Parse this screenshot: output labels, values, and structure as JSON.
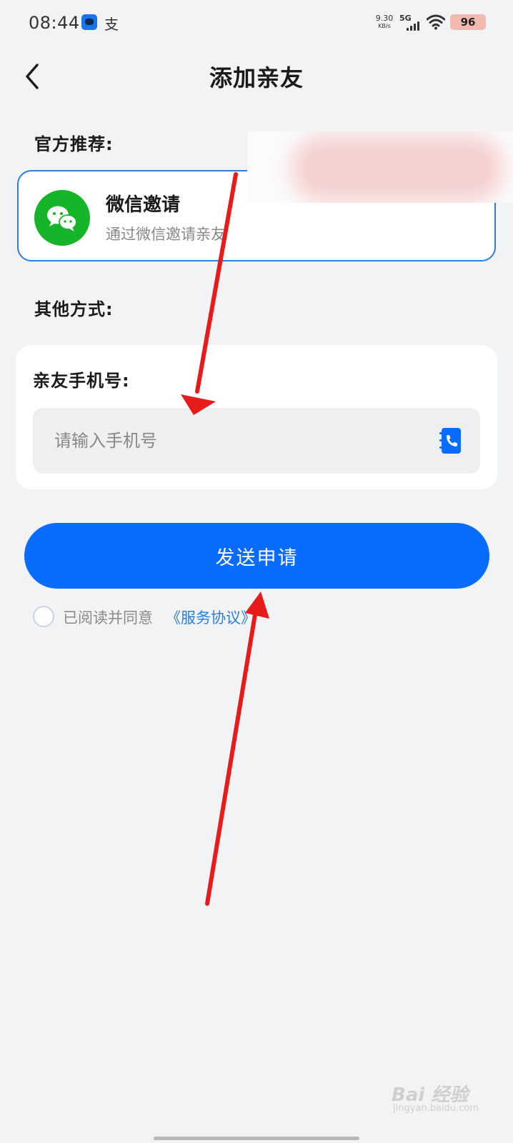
{
  "status_bar": {
    "time": "08:44",
    "app_icons": [
      "app-notification-icon",
      "alipay-icon"
    ],
    "app_glyph": "支",
    "speed_value": "9.30",
    "speed_unit": "KB/s",
    "network": "5G",
    "battery": "96"
  },
  "header": {
    "back_icon": "chevron-left-icon",
    "title": "添加亲友"
  },
  "official": {
    "label": "官方推荐:",
    "wechat_title": "微信邀请",
    "wechat_desc": "通过微信邀请亲友",
    "icon": "wechat-icon"
  },
  "other": {
    "label": "其他方式:",
    "phone_label": "亲友手机号:",
    "phone_value": "",
    "phone_placeholder": "请输入手机号",
    "contacts_icon": "contacts-book-icon"
  },
  "actions": {
    "send_label": "发送申请"
  },
  "agreement": {
    "checked": false,
    "text": "已阅读并同意",
    "link": "《服务协议》"
  },
  "watermark": {
    "logo": "Bai 经验",
    "sub": "jingyan.baidu.com"
  },
  "colors": {
    "background": "#f2f3f5",
    "accent": "#0a6cff",
    "link": "#2a7de1",
    "wechat": "#16b529",
    "annotation_arrow": "#e81b1b"
  }
}
